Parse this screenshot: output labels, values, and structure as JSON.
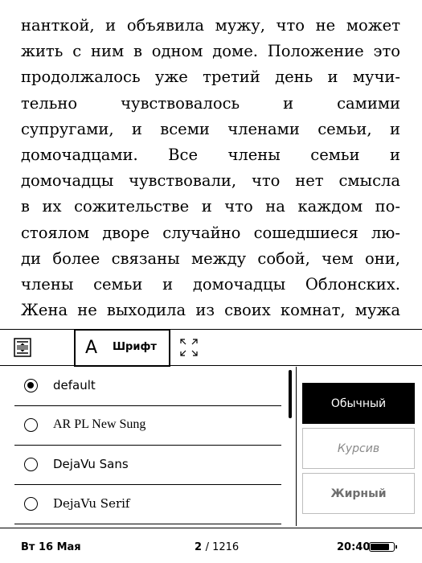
{
  "reading": {
    "lines": [
      "нанткой, и объявила мужу, что не может",
      "жить с ним в одном доме. Положение это",
      "продолжалось уже третий день и мучи-",
      "тельно чувствовалось и самими",
      "супругами, и всеми членами семьи, и",
      "домочадцами. Все члены семьи и",
      "домочадцы чувствовали, что нет смысла",
      "в их сожительстве и что на каждом по-",
      "стоялом дворе случайно сошедшиеся лю-",
      "ди более связаны между собой, чем они,",
      "члены семьи и домочадцы Облонских.",
      "Жена не выходила из своих комнат, мужа"
    ]
  },
  "toolbar": {
    "layout_icon": "text-layout-icon",
    "font_glyph": "A",
    "font_label": "Шрифт",
    "expand_icon": "expand-icon"
  },
  "fonts": {
    "items": [
      {
        "label": "default",
        "selected": true
      },
      {
        "label": "AR PL New Sung",
        "selected": false
      },
      {
        "label": "DejaVu Sans",
        "selected": false
      },
      {
        "label": "DejaVu Serif",
        "selected": false
      }
    ]
  },
  "styles": {
    "regular": "Обычный",
    "italic": "Курсив",
    "bold": "Жирный"
  },
  "status": {
    "date": "Вт 16 Мая",
    "page_current": "2",
    "page_total": "/ 1216",
    "time": "20:40",
    "battery_level": 0.9
  }
}
